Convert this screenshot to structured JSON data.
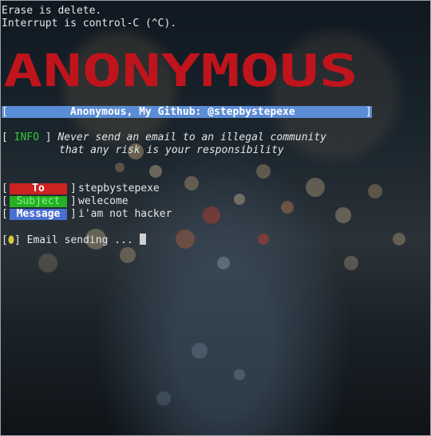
{
  "terminal": {
    "line1": "Erase is delete.",
    "line2": "Interrupt is control-C (^C).",
    "logo_text": "ANONYMOUS",
    "banner": "Anonymous, My Github: @stepbystepexe",
    "info_tag": "INFO",
    "info_line1": "Never send an email to an illegal community",
    "info_line2": "that any risk is your responsibility",
    "fields": [
      {
        "label": "To",
        "value": "stepbystepexe"
      },
      {
        "label": "Subject",
        "value": "welecome"
      },
      {
        "label": "Message",
        "value": "i'am not hacker"
      }
    ],
    "status": "Email sending ..."
  },
  "colors": {
    "logo": "#c0141c",
    "banner": "#5b8cd6",
    "info": "#39c83a",
    "to_tag": "#cc2222",
    "subject_tag": "#23b023",
    "message_tag": "#4b6fd1"
  }
}
